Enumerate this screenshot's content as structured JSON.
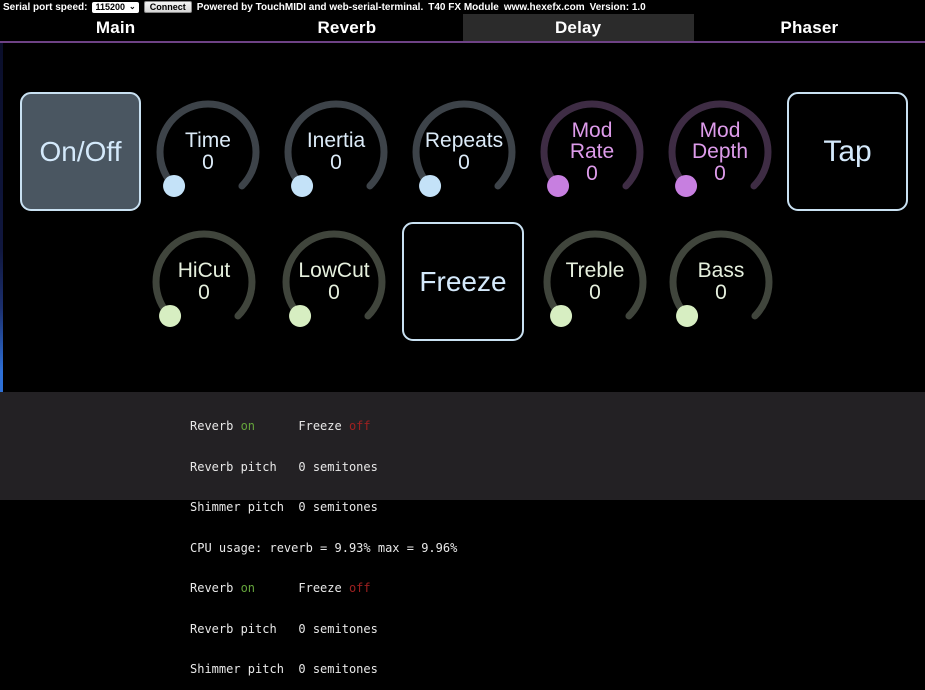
{
  "topbar": {
    "serial_label": "Serial port speed:",
    "speed_value": "115200",
    "connect_label": "Connect",
    "powered_text": "Powered by TouchMIDI and web-serial-terminal.",
    "module_name": "T40 FX Module",
    "site": "www.hexefx.com",
    "version_label": "Version: 1.0"
  },
  "tabs": {
    "items": [
      {
        "label": "Main",
        "active": false
      },
      {
        "label": "Reverb",
        "active": false
      },
      {
        "label": "Delay",
        "active": true
      },
      {
        "label": "Phaser",
        "active": false
      }
    ]
  },
  "buttons": {
    "onoff_label": "On/Off",
    "tap_label": "Tap",
    "freeze_label": "Freeze"
  },
  "knobs": {
    "row1": [
      {
        "label": "Time",
        "value": "0",
        "theme": "blue"
      },
      {
        "label": "Inertia",
        "value": "0",
        "theme": "blue"
      },
      {
        "label": "Repeats",
        "value": "0",
        "theme": "blue"
      },
      {
        "label": "Mod Rate",
        "value": "0",
        "theme": "purple"
      },
      {
        "label": "Mod Depth",
        "value": "0",
        "theme": "purple"
      }
    ],
    "row2": [
      {
        "label": "HiCut",
        "value": "0",
        "theme": "green"
      },
      {
        "label": "LowCut",
        "value": "0",
        "theme": "green"
      },
      {
        "label": "Treble",
        "value": "0",
        "theme": "green"
      },
      {
        "label": "Bass",
        "value": "0",
        "theme": "green"
      }
    ]
  },
  "terminal": {
    "lines": [
      {
        "segments": [
          {
            "text": "Reverb ",
            "color": "fg"
          },
          {
            "text": "on",
            "color": "green"
          },
          {
            "text": "      Freeze ",
            "color": "fg"
          },
          {
            "text": "off",
            "color": "red"
          }
        ]
      },
      {
        "segments": [
          {
            "text": "Reverb pitch   0 semitones",
            "color": "fg"
          }
        ]
      },
      {
        "segments": [
          {
            "text": "Shimmer pitch  0 semitones",
            "color": "fg"
          }
        ]
      },
      {
        "segments": [
          {
            "text": "CPU usage: reverb = 9.93% max = 9.96%",
            "color": "fg"
          }
        ]
      },
      {
        "segments": [
          {
            "text": "Reverb ",
            "color": "fg"
          },
          {
            "text": "on",
            "color": "green"
          },
          {
            "text": "      Freeze ",
            "color": "fg"
          },
          {
            "text": "off",
            "color": "red"
          }
        ]
      },
      {
        "segments": [
          {
            "text": "Reverb pitch   0 semitones",
            "color": "fg"
          }
        ]
      },
      {
        "segments": [
          {
            "text": "Shimmer pitch  0 semitones",
            "color": "fg"
          }
        ]
      }
    ]
  },
  "colors": {
    "tab_underline": "#6e4285",
    "active_tab_bg": "#2b2b2b",
    "knob_blue_dot": "#c4e2f8",
    "knob_purple_dot": "#c77fe0",
    "knob_green_dot": "#d7eec2",
    "button_border": "#c9e1f2",
    "onoff_fill": "#4a5661",
    "terminal_bg": "#232124",
    "status_on_green": "#64a43b",
    "status_off_red": "#9e2020"
  }
}
